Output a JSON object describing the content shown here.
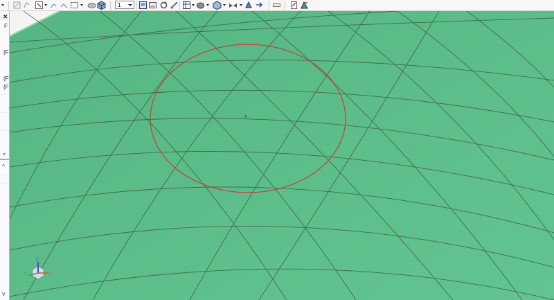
{
  "toolbar": {
    "dropdown_value": "1",
    "icons": [
      "arrow-dropdown-icon",
      "fit-view-icon",
      "rotate-view-icon",
      "select-mode-icon",
      "pan-icon",
      "rotate-icon",
      "box-select-icon",
      "view-cube-icon",
      "shaded-icon",
      "view-front-icon",
      "view-back-icon",
      "refresh-icon",
      "measure-icon",
      "render-icon",
      "display-mode-icon",
      "view-3d-icon",
      "section-icon",
      "analysis-icon",
      "navigate-icon",
      "ruler-icon",
      "import-icon",
      "export-icon"
    ]
  },
  "left_panel": {
    "items": [
      "F",
      "(F",
      "(F",
      "(F"
    ],
    "close_glyph": "✕",
    "up_glyph": "^",
    "down_glyph": "v"
  },
  "viewport": {
    "surface_color": "#5cbd87",
    "grid_color": "#3a5a3e",
    "circle_color": "#cc3a3a",
    "triad_labels": {
      "x": "X",
      "y": "Y",
      "z": "Z"
    }
  }
}
